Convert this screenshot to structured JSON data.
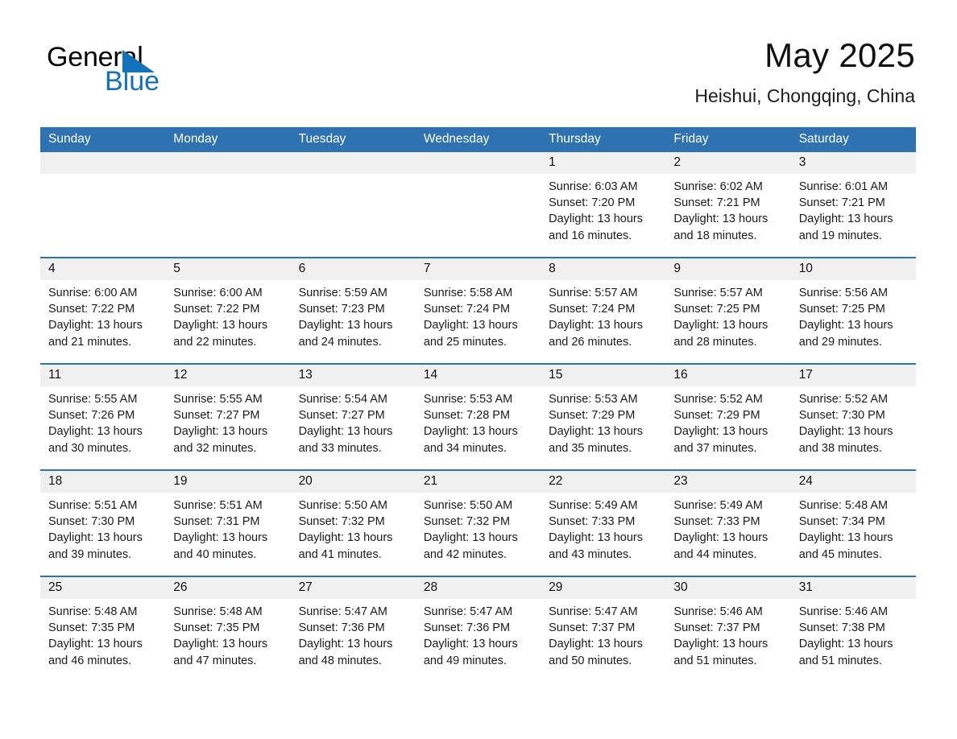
{
  "logo": {
    "word1": "General",
    "word2": "Blue",
    "triangle_color": "#1272bb",
    "icon": "triangle-icon"
  },
  "header": {
    "title": "May 2025",
    "subtitle": "Heishui, Chongqing, China"
  },
  "theme": {
    "header_blue": "#2e72b1",
    "daynum_band": "#f0f0f0",
    "text": "#1a1a1a"
  },
  "calendar": {
    "weekday_headers": [
      "Sunday",
      "Monday",
      "Tuesday",
      "Wednesday",
      "Thursday",
      "Friday",
      "Saturday"
    ],
    "weeks": [
      [
        {
          "day": "",
          "lines": []
        },
        {
          "day": "",
          "lines": []
        },
        {
          "day": "",
          "lines": []
        },
        {
          "day": "",
          "lines": []
        },
        {
          "day": "1",
          "lines": [
            "Sunrise: 6:03 AM",
            "Sunset: 7:20 PM",
            "Daylight: 13 hours",
            "and 16 minutes."
          ]
        },
        {
          "day": "2",
          "lines": [
            "Sunrise: 6:02 AM",
            "Sunset: 7:21 PM",
            "Daylight: 13 hours",
            "and 18 minutes."
          ]
        },
        {
          "day": "3",
          "lines": [
            "Sunrise: 6:01 AM",
            "Sunset: 7:21 PM",
            "Daylight: 13 hours",
            "and 19 minutes."
          ]
        }
      ],
      [
        {
          "day": "4",
          "lines": [
            "Sunrise: 6:00 AM",
            "Sunset: 7:22 PM",
            "Daylight: 13 hours",
            "and 21 minutes."
          ]
        },
        {
          "day": "5",
          "lines": [
            "Sunrise: 6:00 AM",
            "Sunset: 7:22 PM",
            "Daylight: 13 hours",
            "and 22 minutes."
          ]
        },
        {
          "day": "6",
          "lines": [
            "Sunrise: 5:59 AM",
            "Sunset: 7:23 PM",
            "Daylight: 13 hours",
            "and 24 minutes."
          ]
        },
        {
          "day": "7",
          "lines": [
            "Sunrise: 5:58 AM",
            "Sunset: 7:24 PM",
            "Daylight: 13 hours",
            "and 25 minutes."
          ]
        },
        {
          "day": "8",
          "lines": [
            "Sunrise: 5:57 AM",
            "Sunset: 7:24 PM",
            "Daylight: 13 hours",
            "and 26 minutes."
          ]
        },
        {
          "day": "9",
          "lines": [
            "Sunrise: 5:57 AM",
            "Sunset: 7:25 PM",
            "Daylight: 13 hours",
            "and 28 minutes."
          ]
        },
        {
          "day": "10",
          "lines": [
            "Sunrise: 5:56 AM",
            "Sunset: 7:25 PM",
            "Daylight: 13 hours",
            "and 29 minutes."
          ]
        }
      ],
      [
        {
          "day": "11",
          "lines": [
            "Sunrise: 5:55 AM",
            "Sunset: 7:26 PM",
            "Daylight: 13 hours",
            "and 30 minutes."
          ]
        },
        {
          "day": "12",
          "lines": [
            "Sunrise: 5:55 AM",
            "Sunset: 7:27 PM",
            "Daylight: 13 hours",
            "and 32 minutes."
          ]
        },
        {
          "day": "13",
          "lines": [
            "Sunrise: 5:54 AM",
            "Sunset: 7:27 PM",
            "Daylight: 13 hours",
            "and 33 minutes."
          ]
        },
        {
          "day": "14",
          "lines": [
            "Sunrise: 5:53 AM",
            "Sunset: 7:28 PM",
            "Daylight: 13 hours",
            "and 34 minutes."
          ]
        },
        {
          "day": "15",
          "lines": [
            "Sunrise: 5:53 AM",
            "Sunset: 7:29 PM",
            "Daylight: 13 hours",
            "and 35 minutes."
          ]
        },
        {
          "day": "16",
          "lines": [
            "Sunrise: 5:52 AM",
            "Sunset: 7:29 PM",
            "Daylight: 13 hours",
            "and 37 minutes."
          ]
        },
        {
          "day": "17",
          "lines": [
            "Sunrise: 5:52 AM",
            "Sunset: 7:30 PM",
            "Daylight: 13 hours",
            "and 38 minutes."
          ]
        }
      ],
      [
        {
          "day": "18",
          "lines": [
            "Sunrise: 5:51 AM",
            "Sunset: 7:30 PM",
            "Daylight: 13 hours",
            "and 39 minutes."
          ]
        },
        {
          "day": "19",
          "lines": [
            "Sunrise: 5:51 AM",
            "Sunset: 7:31 PM",
            "Daylight: 13 hours",
            "and 40 minutes."
          ]
        },
        {
          "day": "20",
          "lines": [
            "Sunrise: 5:50 AM",
            "Sunset: 7:32 PM",
            "Daylight: 13 hours",
            "and 41 minutes."
          ]
        },
        {
          "day": "21",
          "lines": [
            "Sunrise: 5:50 AM",
            "Sunset: 7:32 PM",
            "Daylight: 13 hours",
            "and 42 minutes."
          ]
        },
        {
          "day": "22",
          "lines": [
            "Sunrise: 5:49 AM",
            "Sunset: 7:33 PM",
            "Daylight: 13 hours",
            "and 43 minutes."
          ]
        },
        {
          "day": "23",
          "lines": [
            "Sunrise: 5:49 AM",
            "Sunset: 7:33 PM",
            "Daylight: 13 hours",
            "and 44 minutes."
          ]
        },
        {
          "day": "24",
          "lines": [
            "Sunrise: 5:48 AM",
            "Sunset: 7:34 PM",
            "Daylight: 13 hours",
            "and 45 minutes."
          ]
        }
      ],
      [
        {
          "day": "25",
          "lines": [
            "Sunrise: 5:48 AM",
            "Sunset: 7:35 PM",
            "Daylight: 13 hours",
            "and 46 minutes."
          ]
        },
        {
          "day": "26",
          "lines": [
            "Sunrise: 5:48 AM",
            "Sunset: 7:35 PM",
            "Daylight: 13 hours",
            "and 47 minutes."
          ]
        },
        {
          "day": "27",
          "lines": [
            "Sunrise: 5:47 AM",
            "Sunset: 7:36 PM",
            "Daylight: 13 hours",
            "and 48 minutes."
          ]
        },
        {
          "day": "28",
          "lines": [
            "Sunrise: 5:47 AM",
            "Sunset: 7:36 PM",
            "Daylight: 13 hours",
            "and 49 minutes."
          ]
        },
        {
          "day": "29",
          "lines": [
            "Sunrise: 5:47 AM",
            "Sunset: 7:37 PM",
            "Daylight: 13 hours",
            "and 50 minutes."
          ]
        },
        {
          "day": "30",
          "lines": [
            "Sunrise: 5:46 AM",
            "Sunset: 7:37 PM",
            "Daylight: 13 hours",
            "and 51 minutes."
          ]
        },
        {
          "day": "31",
          "lines": [
            "Sunrise: 5:46 AM",
            "Sunset: 7:38 PM",
            "Daylight: 13 hours",
            "and 51 minutes."
          ]
        }
      ]
    ]
  }
}
